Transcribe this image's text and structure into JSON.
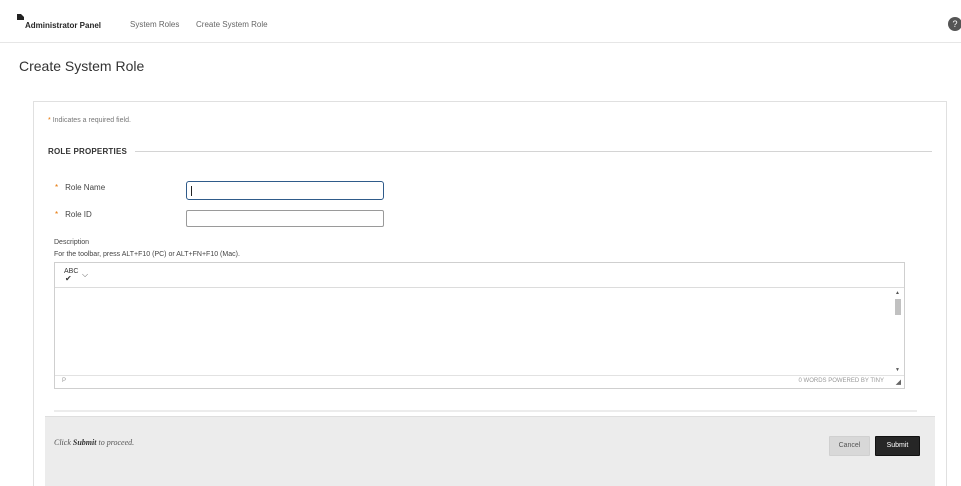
{
  "breadcrumb": {
    "items": [
      "Administrator Panel",
      "System Roles",
      "Create System Role"
    ]
  },
  "help": {
    "glyph": "?"
  },
  "page": {
    "title": "Create System Role"
  },
  "form": {
    "required_star": "*",
    "required_note": "Indicates a required field.",
    "section_title": "ROLE PROPERTIES",
    "role_name": {
      "label": "Role Name",
      "value": ""
    },
    "role_id": {
      "label": "Role ID",
      "value": ""
    },
    "description": {
      "label": "Description",
      "help": "For the toolbar, press ALT+F10 (PC) or ALT+FN+F10 (Mac).",
      "path": "P",
      "wordcount": "0 WORDS  POWERED BY TINY",
      "spell_top": "ABC",
      "spell_check": "✔",
      "dropdown": "⌵",
      "resize": "◢"
    }
  },
  "footer": {
    "hint_prefix": "Click ",
    "hint_bold": "Submit",
    "hint_suffix": " to proceed.",
    "cancel_label": "Cancel",
    "submit_label": "Submit"
  },
  "colors": {
    "accent": "#e67300",
    "focus_border": "#2f5b8a",
    "submit_bg": "#262626"
  }
}
